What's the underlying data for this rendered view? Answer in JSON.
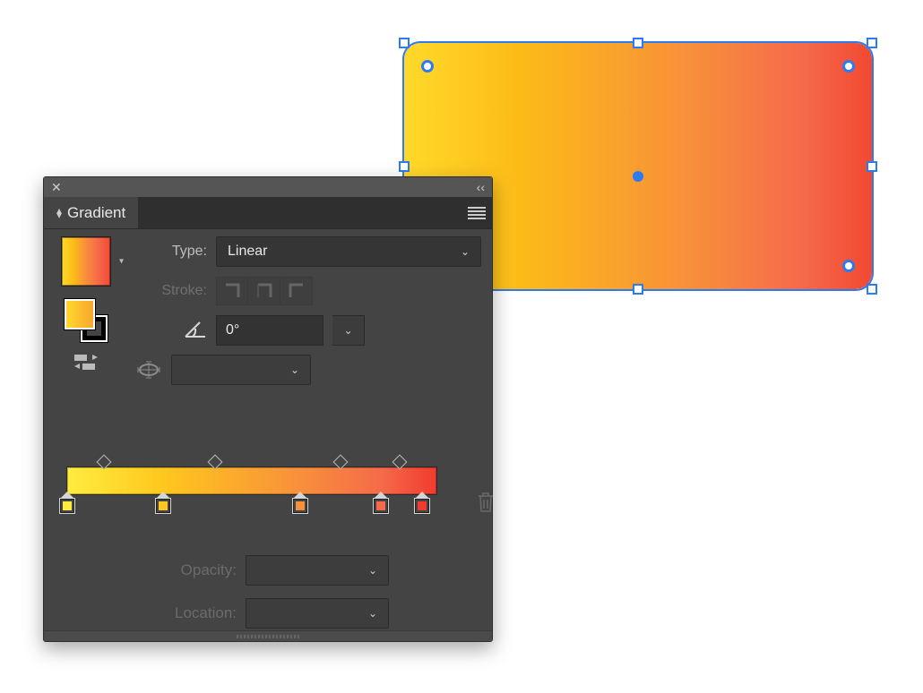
{
  "panel": {
    "title": "Gradient",
    "type_label": "Type:",
    "type_value": "Linear",
    "stroke_label": "Stroke:",
    "angle_value": "0°",
    "opacity_label": "Opacity:",
    "opacity_value": "",
    "location_label": "Location:",
    "location_value": ""
  },
  "gradient": {
    "stops": [
      {
        "pos": 0,
        "color": "#FFEC3F"
      },
      {
        "pos": 26,
        "color": "#FFC71D"
      },
      {
        "pos": 63,
        "color": "#F7903B"
      },
      {
        "pos": 85,
        "color": "#F56A4A"
      },
      {
        "pos": 96,
        "color": "#F13B2E"
      }
    ],
    "midpoints": [
      10,
      40,
      74,
      90
    ]
  }
}
